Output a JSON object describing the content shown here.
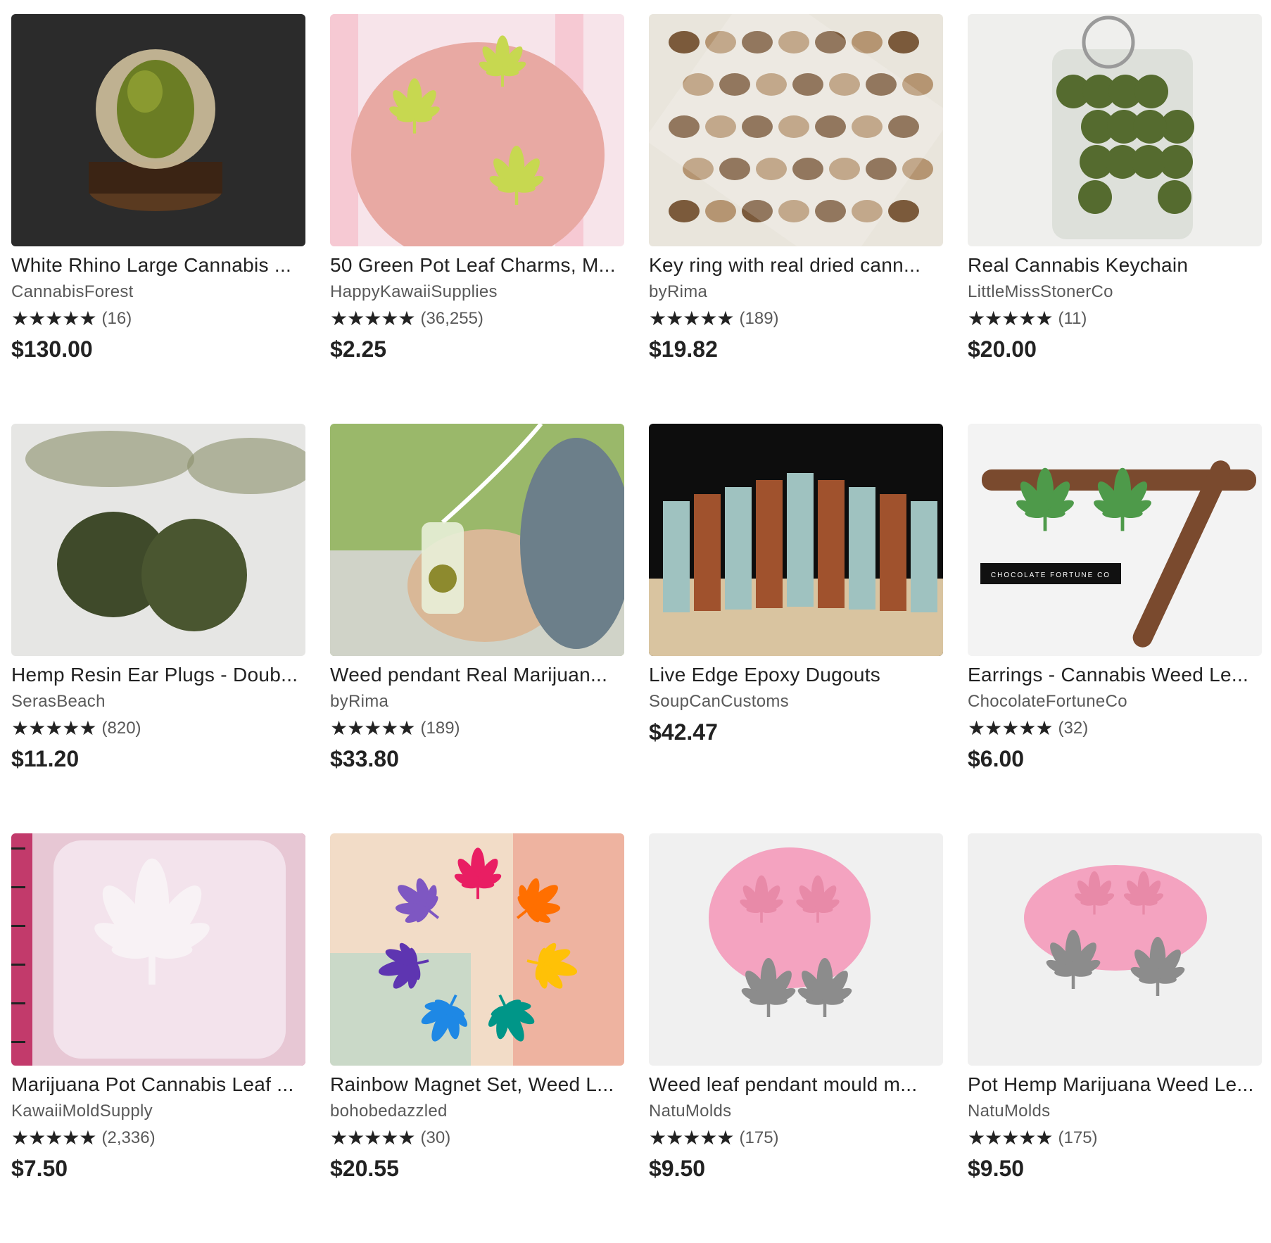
{
  "listings": [
    {
      "title": "White Rhino Large Cannabis ...",
      "shop": "CannabisForest",
      "stars": "★★★★★",
      "reviews": "(16)",
      "price": "$130.00",
      "rating": 5,
      "image": "cannabis-bud-in-resin-globe",
      "palette": [
        "#2b2b2b",
        "#6b7d24",
        "#d9c9a3"
      ]
    },
    {
      "title": "50 Green Pot Leaf Charms, M...",
      "shop": "HappyKawaiiSupplies",
      "stars": "★★★★★",
      "reviews": "(36,255)",
      "price": "$2.25",
      "rating": 5,
      "image": "green-leaf-charms-on-hand",
      "palette": [
        "#f6c9d3",
        "#e8a9a3",
        "#c7d850"
      ]
    },
    {
      "title": "Key ring with real dried cann...",
      "shop": "byRima",
      "stars": "★★★★★",
      "reviews": "(189)",
      "price": "$19.82",
      "rating": 5,
      "image": "seeds-in-resin-block",
      "palette": [
        "#e9e5dc",
        "#b59572",
        "#7b5a3b"
      ]
    },
    {
      "title": "Real Cannabis Keychain",
      "shop": "LittleMissStonerCo",
      "stars": "★★★★★",
      "reviews": "(11)",
      "price": "$20.00",
      "rating": 5,
      "image": "buds-in-clear-keychain",
      "palette": [
        "#efefed",
        "#556b2f",
        "#9a9a9a"
      ]
    },
    {
      "title": "Hemp Resin Ear Plugs - Doub...",
      "shop": "SerasBeach",
      "stars": "★★★★★",
      "reviews": "(820)",
      "price": "$11.20",
      "rating": 5,
      "image": "resin-ear-plugs",
      "palette": [
        "#e6e6e4",
        "#3f4a2a",
        "#8a8f6a"
      ]
    },
    {
      "title": "Weed pendant Real Marijuan...",
      "shop": "byRima",
      "stars": "★★★★★",
      "reviews": "(189)",
      "price": "$33.80",
      "rating": 5,
      "image": "resin-pendant-on-rocks",
      "palette": [
        "#9ab86a",
        "#6c7f8a",
        "#d9b897"
      ]
    },
    {
      "title": "Live Edge Epoxy Dugouts",
      "shop": "SoupCanCustoms",
      "stars": "",
      "reviews": "",
      "price": "$42.47",
      "rating": 0,
      "image": "wood-epoxy-dugouts",
      "palette": [
        "#0d0d0d",
        "#a0522d",
        "#9fc2c0"
      ]
    },
    {
      "title": "Earrings - Cannabis Weed Le...",
      "shop": "ChocolateFortuneCo",
      "stars": "★★★★★",
      "reviews": "(32)",
      "price": "$6.00",
      "rating": 5,
      "image": "leaf-earrings-and-cigar",
      "palette": [
        "#f3f3f3",
        "#4e9a4a",
        "#7a4a2e"
      ],
      "watermark": "CHOCOLATE FORTUNE CO"
    },
    {
      "title": "Marijuana Pot Cannabis Leaf ...",
      "shop": "KawaiiMoldSupply",
      "stars": "★★★★★",
      "reviews": "(2,336)",
      "price": "$7.50",
      "rating": 5,
      "image": "clear-leaf-mold-on-ruler",
      "palette": [
        "#e7c7d4",
        "#f4e6ee",
        "#c23a6b"
      ]
    },
    {
      "title": "Rainbow Magnet Set, Weed L...",
      "shop": "bohobedazzled",
      "stars": "★★★★★",
      "reviews": "(30)",
      "price": "$20.55",
      "rating": 5,
      "image": "rainbow-leaf-magnets",
      "palette": [
        "#f2dcc7",
        "#b9d7c9",
        "#e98a7a"
      ]
    },
    {
      "title": "Weed leaf pendant mould m...",
      "shop": "NatuMolds",
      "stars": "★★★★★",
      "reviews": "(175)",
      "price": "$9.50",
      "rating": 5,
      "image": "pink-mold-with-silver-charms",
      "palette": [
        "#f0f0f0",
        "#f4a3c0",
        "#8c8c8c"
      ]
    },
    {
      "title": "Pot Hemp Marijuana Weed Le...",
      "shop": "NatuMolds",
      "stars": "★★★★★",
      "reviews": "(175)",
      "price": "$9.50",
      "rating": 5,
      "image": "pink-mold-with-silver-charms-2",
      "palette": [
        "#f0f0f0",
        "#f4a3c0",
        "#8c8c8c"
      ]
    }
  ]
}
